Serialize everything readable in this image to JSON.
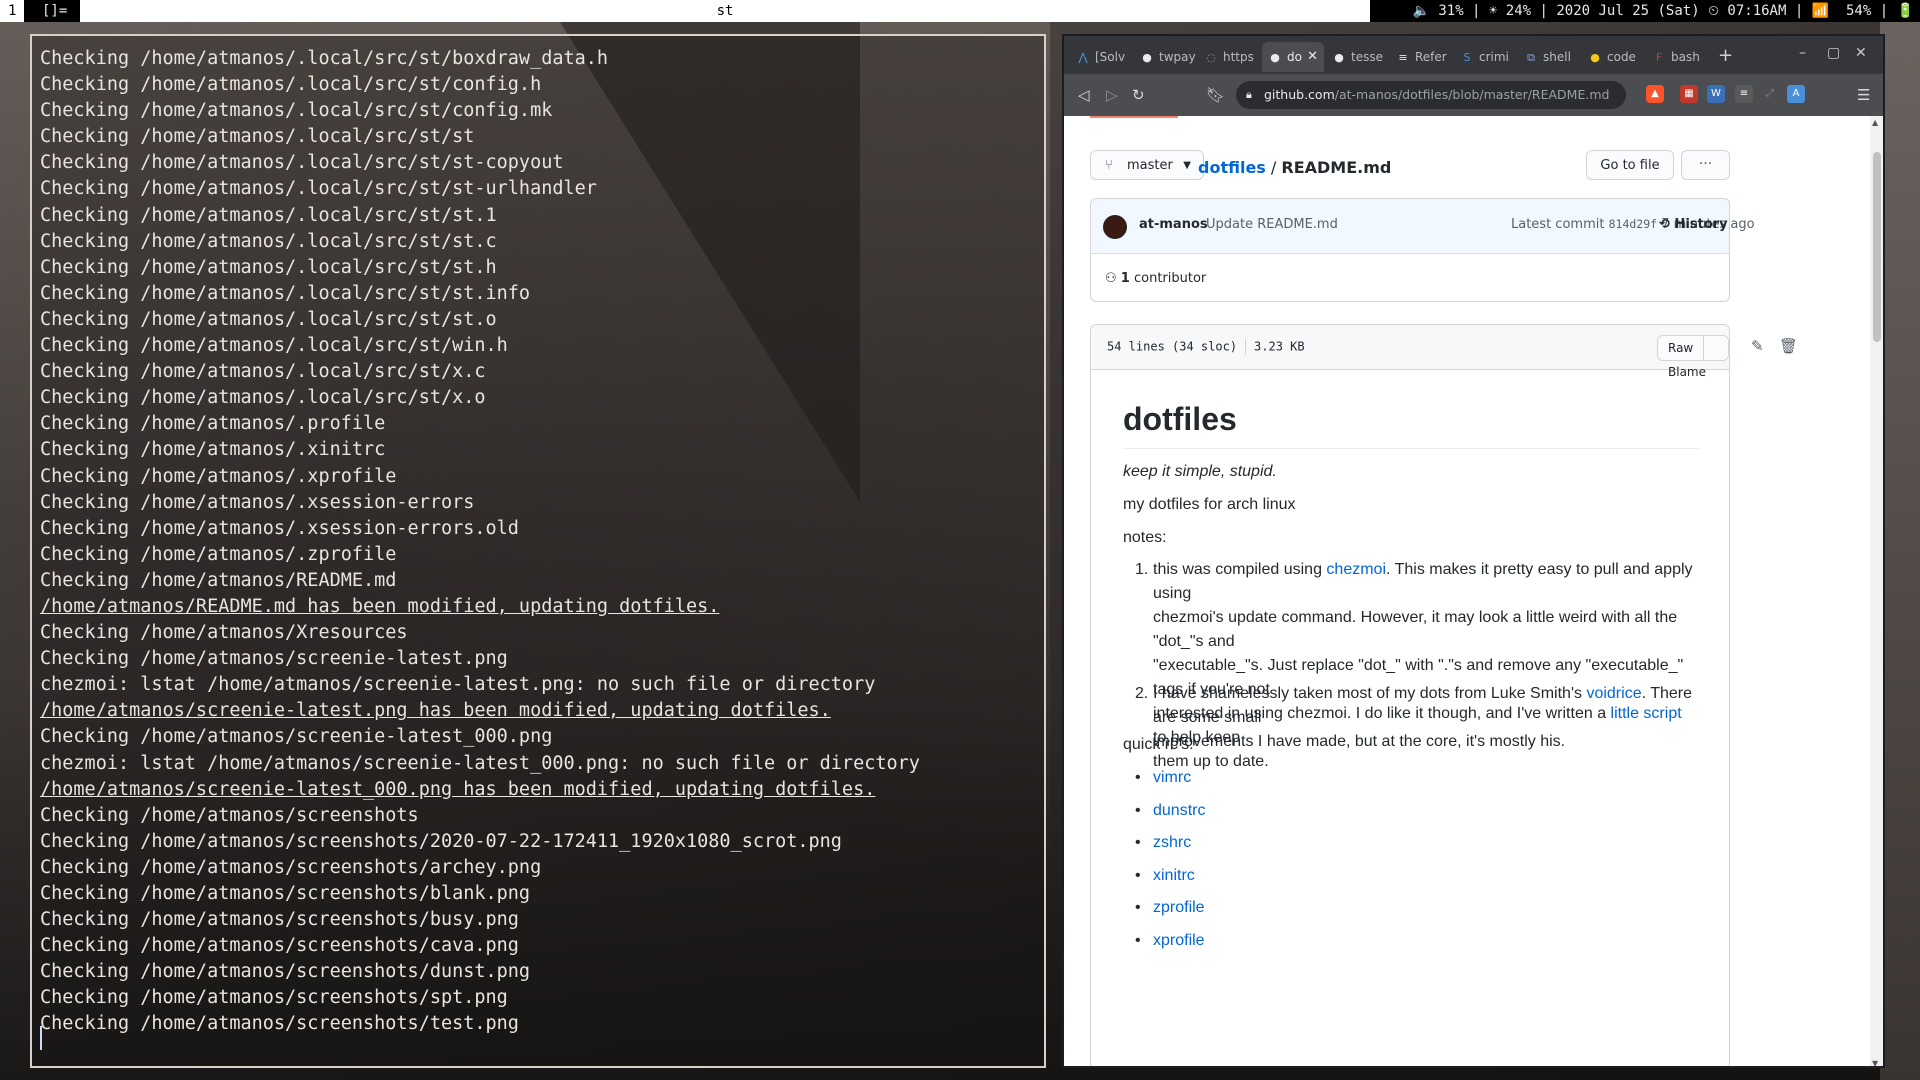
{
  "topbar": {
    "workspace": "1",
    "layout": "[]=",
    "window_title": "st",
    "status": "🔈 31% | ☀ 24% | 2020 Jul 25 (Sat) ⏲ 07:16AM | 📶  54% | 🔋"
  },
  "terminal": {
    "lines": [
      {
        "text": "Checking /home/atmanos/.local/src/st/boxdraw_data.h",
        "u": false
      },
      {
        "text": "Checking /home/atmanos/.local/src/st/config.h",
        "u": false
      },
      {
        "text": "Checking /home/atmanos/.local/src/st/config.mk",
        "u": false
      },
      {
        "text": "Checking /home/atmanos/.local/src/st/st",
        "u": false
      },
      {
        "text": "Checking /home/atmanos/.local/src/st/st-copyout",
        "u": false
      },
      {
        "text": "Checking /home/atmanos/.local/src/st/st-urlhandler",
        "u": false
      },
      {
        "text": "Checking /home/atmanos/.local/src/st/st.1",
        "u": false
      },
      {
        "text": "Checking /home/atmanos/.local/src/st/st.c",
        "u": false
      },
      {
        "text": "Checking /home/atmanos/.local/src/st/st.h",
        "u": false
      },
      {
        "text": "Checking /home/atmanos/.local/src/st/st.info",
        "u": false
      },
      {
        "text": "Checking /home/atmanos/.local/src/st/st.o",
        "u": false
      },
      {
        "text": "Checking /home/atmanos/.local/src/st/win.h",
        "u": false
      },
      {
        "text": "Checking /home/atmanos/.local/src/st/x.c",
        "u": false
      },
      {
        "text": "Checking /home/atmanos/.local/src/st/x.o",
        "u": false
      },
      {
        "text": "Checking /home/atmanos/.profile",
        "u": false
      },
      {
        "text": "Checking /home/atmanos/.xinitrc",
        "u": false
      },
      {
        "text": "Checking /home/atmanos/.xprofile",
        "u": false
      },
      {
        "text": "Checking /home/atmanos/.xsession-errors",
        "u": false
      },
      {
        "text": "Checking /home/atmanos/.xsession-errors.old",
        "u": false
      },
      {
        "text": "Checking /home/atmanos/.zprofile",
        "u": false
      },
      {
        "text": "Checking /home/atmanos/README.md",
        "u": false
      },
      {
        "text": "/home/atmanos/README.md has been modified, updating dotfiles.",
        "u": true
      },
      {
        "text": "Checking /home/atmanos/Xresources",
        "u": false
      },
      {
        "text": "Checking /home/atmanos/screenie-latest.png",
        "u": false
      },
      {
        "text": "chezmoi: lstat /home/atmanos/screenie-latest.png: no such file or directory",
        "u": false
      },
      {
        "text": "/home/atmanos/screenie-latest.png has been modified, updating dotfiles.",
        "u": true
      },
      {
        "text": "Checking /home/atmanos/screenie-latest_000.png",
        "u": false
      },
      {
        "text": "chezmoi: lstat /home/atmanos/screenie-latest_000.png: no such file or directory",
        "u": false
      },
      {
        "text": "/home/atmanos/screenie-latest_000.png has been modified, updating dotfiles.",
        "u": true
      },
      {
        "text": "Checking /home/atmanos/screenshots",
        "u": false
      },
      {
        "text": "Checking /home/atmanos/screenshots/2020-07-22-172411_1920x1080_scrot.png",
        "u": false
      },
      {
        "text": "Checking /home/atmanos/screenshots/archey.png",
        "u": false
      },
      {
        "text": "Checking /home/atmanos/screenshots/blank.png",
        "u": false
      },
      {
        "text": "Checking /home/atmanos/screenshots/busy.png",
        "u": false
      },
      {
        "text": "Checking /home/atmanos/screenshots/cava.png",
        "u": false
      },
      {
        "text": "Checking /home/atmanos/screenshots/dunst.png",
        "u": false
      },
      {
        "text": "Checking /home/atmanos/screenshots/spt.png",
        "u": false
      },
      {
        "text": "Checking /home/atmanos/screenshots/test.png",
        "u": false
      }
    ]
  },
  "browser": {
    "tabs": [
      {
        "label": "[Solv",
        "icon": "arch-icon",
        "glyph": "⋀",
        "color": "#4f9fe0"
      },
      {
        "label": "twpay",
        "icon": "github-icon",
        "glyph": "●",
        "color": "#e8eaed"
      },
      {
        "label": "https",
        "icon": "globe-icon",
        "glyph": "◌",
        "color": "#9aa0a6"
      },
      {
        "label": "do",
        "icon": "github-icon",
        "glyph": "●",
        "color": "#e8eaed",
        "active": true
      },
      {
        "label": "tesse",
        "icon": "github-icon",
        "glyph": "●",
        "color": "#e8eaed"
      },
      {
        "label": "Refer",
        "icon": "doc-icon",
        "glyph": "≡",
        "color": "#e8eaed"
      },
      {
        "label": "crimi",
        "icon": "stackexchange-icon",
        "glyph": "S",
        "color": "#4a90d9"
      },
      {
        "label": "shell",
        "icon": "unix-icon",
        "glyph": "⧉",
        "color": "#8aa4d6"
      },
      {
        "label": "code",
        "icon": "dot-icon",
        "glyph": "●",
        "color": "#f5c518"
      },
      {
        "label": "bash",
        "icon": "f-icon",
        "glyph": "F",
        "color": "#e2312d"
      }
    ],
    "new_tab": "+",
    "url_host": "github.com",
    "url_path": "/at-manos/dotfiles/blob/master/README.md"
  },
  "github": {
    "branch": "master",
    "repo": "dotfiles",
    "separator": "/",
    "file": "README.md",
    "go_to_file": "Go to file",
    "more": "···",
    "commit": {
      "author": "at-manos",
      "message": "Update README.md",
      "latest_label": "Latest commit",
      "sha": "814d29f",
      "age": "7 minutes ago",
      "history": "History"
    },
    "contributors_count": "1",
    "contributors_label": "contributor",
    "file_lines": "54 lines (34 sloc)",
    "file_size": "3.23 KB",
    "raw": "Raw",
    "blame": "Blame"
  },
  "readme": {
    "title": "dotfiles",
    "tagline": "keep it simple, stupid.",
    "intro": "my dotfiles for arch linux",
    "notes_label": "notes:",
    "note1": {
      "l1_a": "this was compiled using ",
      "l1_link": "chezmoi",
      "l1_b": ". This makes it pretty easy to pull and apply using",
      "l2": "chezmoi's update command. However, it may look a little weird with all the \"dot_\"s and",
      "l3": "\"executable_\"s. Just replace \"dot_\" with \".\"s and remove any \"executable_\" tags if you're not",
      "l4_a": "interested in using chezmoi. I do like it though, and I've written a ",
      "l4_link": "little script",
      "l4_b": " to help keep",
      "l5": "them up to date."
    },
    "note2": {
      "l1_a": "I have shamelessly taken most of my dots from Luke Smith's ",
      "l1_link": "voidrice",
      "l1_b": ". There are some small",
      "l2": "improvements I have made, but at the core, it's mostly his."
    },
    "quick_label": "quick rc's:",
    "links": [
      "vimrc",
      "dunstrc",
      "zshrc",
      "xinitrc",
      "zprofile",
      "xprofile"
    ]
  }
}
